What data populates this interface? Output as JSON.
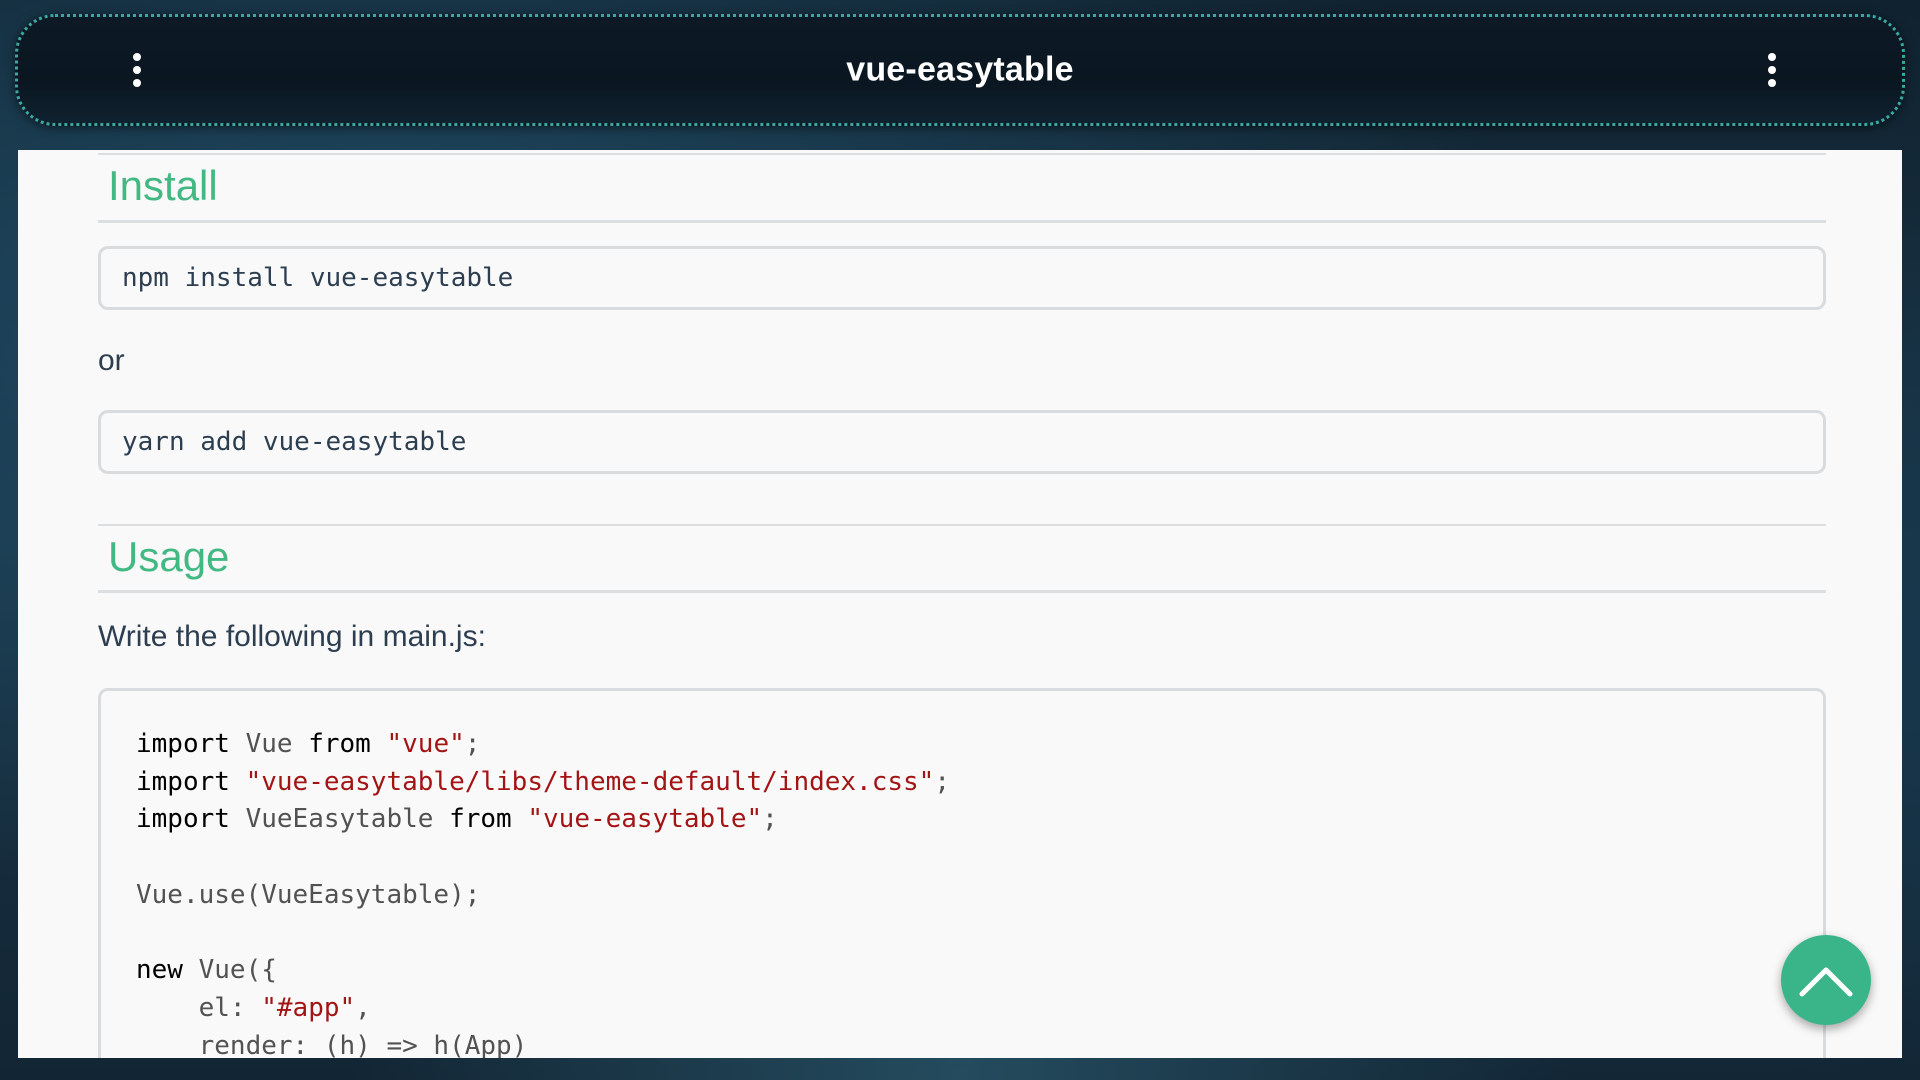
{
  "app": {
    "title": "vue-easytable"
  },
  "topbar": {
    "left_menu_icon": "more-vertical-icon",
    "right_menu_icon": "more-vertical-icon"
  },
  "install": {
    "heading": "Install",
    "npm_command": "npm install vue-easytable",
    "or_text": "or",
    "yarn_command": "yarn add vue-easytable"
  },
  "usage": {
    "heading": "Usage",
    "intro": "Write the following in main.js:",
    "code_lines": [
      [
        {
          "t": "import",
          "c": "kw"
        },
        {
          "t": " Vue ",
          "c": "plain"
        },
        {
          "t": "from",
          "c": "kw"
        },
        {
          "t": " ",
          "c": "plain"
        },
        {
          "t": "\"vue\"",
          "c": "str"
        },
        {
          "t": ";",
          "c": "plain"
        }
      ],
      [
        {
          "t": "import",
          "c": "kw"
        },
        {
          "t": " ",
          "c": "plain"
        },
        {
          "t": "\"vue-easytable/libs/theme-default/index.css\"",
          "c": "str"
        },
        {
          "t": ";",
          "c": "plain"
        }
      ],
      [
        {
          "t": "import",
          "c": "kw"
        },
        {
          "t": " VueEasytable ",
          "c": "plain"
        },
        {
          "t": "from",
          "c": "kw"
        },
        {
          "t": " ",
          "c": "plain"
        },
        {
          "t": "\"vue-easytable\"",
          "c": "str"
        },
        {
          "t": ";",
          "c": "plain"
        }
      ],
      [],
      [
        {
          "t": "Vue.use(VueEasytable);",
          "c": "plain"
        }
      ],
      [],
      [
        {
          "t": "new",
          "c": "kw"
        },
        {
          "t": " Vue({",
          "c": "plain"
        }
      ],
      [
        {
          "t": "    el: ",
          "c": "plain"
        },
        {
          "t": "\"#app\"",
          "c": "str"
        },
        {
          "t": ",",
          "c": "plain"
        }
      ],
      [
        {
          "t": "    render: (h) => h(App)",
          "c": "plain"
        }
      ]
    ]
  },
  "fab": {
    "icon": "chevron-up-icon"
  },
  "colors": {
    "accent": "#42b983",
    "fab": "#3ab58a",
    "string": "#a31515",
    "topbar_border": "#3aa8a0"
  }
}
